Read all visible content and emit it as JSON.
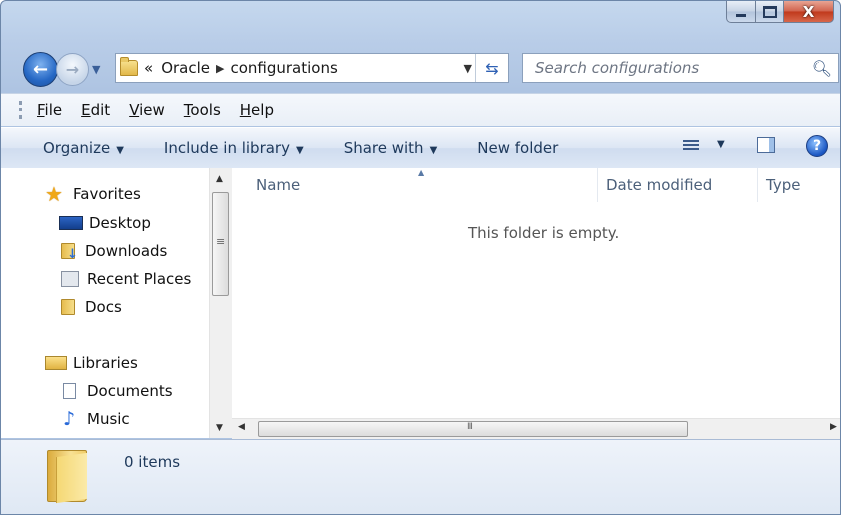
{
  "window": {
    "caption_buttons": {
      "minimize": "minimize-icon",
      "maximize": "maximize-icon",
      "close": "close-icon",
      "close_glyph": "X"
    }
  },
  "address_bar": {
    "overflow": "«",
    "breadcrumbs": [
      "Oracle",
      "configurations"
    ],
    "refresh_icon": "refresh-icon"
  },
  "search": {
    "placeholder": "Search configurations"
  },
  "menu": [
    {
      "label": "File",
      "accel": "F",
      "rest": "ile"
    },
    {
      "label": "Edit",
      "accel": "E",
      "rest": "dit"
    },
    {
      "label": "View",
      "accel": "V",
      "rest": "iew"
    },
    {
      "label": "Tools",
      "accel": "T",
      "rest": "ools"
    },
    {
      "label": "Help",
      "accel": "H",
      "rest": "elp"
    }
  ],
  "commands": {
    "organize": "Organize",
    "include_in_library": "Include in library",
    "share_with": "Share with",
    "new_folder": "New folder"
  },
  "nav_pane": {
    "favorites_header": "Favorites",
    "favorites": [
      "Desktop",
      "Downloads",
      "Recent Places",
      "Docs"
    ],
    "libraries_header": "Libraries",
    "libraries": [
      "Documents",
      "Music"
    ]
  },
  "columns": {
    "name": "Name",
    "date_modified": "Date modified",
    "type": "Type"
  },
  "content": {
    "empty_message": "This folder is empty."
  },
  "details": {
    "item_count": "0 items"
  },
  "colors": {
    "accent": "#1e395b",
    "chrome": "#b9cde8",
    "close": "#c0381b"
  }
}
